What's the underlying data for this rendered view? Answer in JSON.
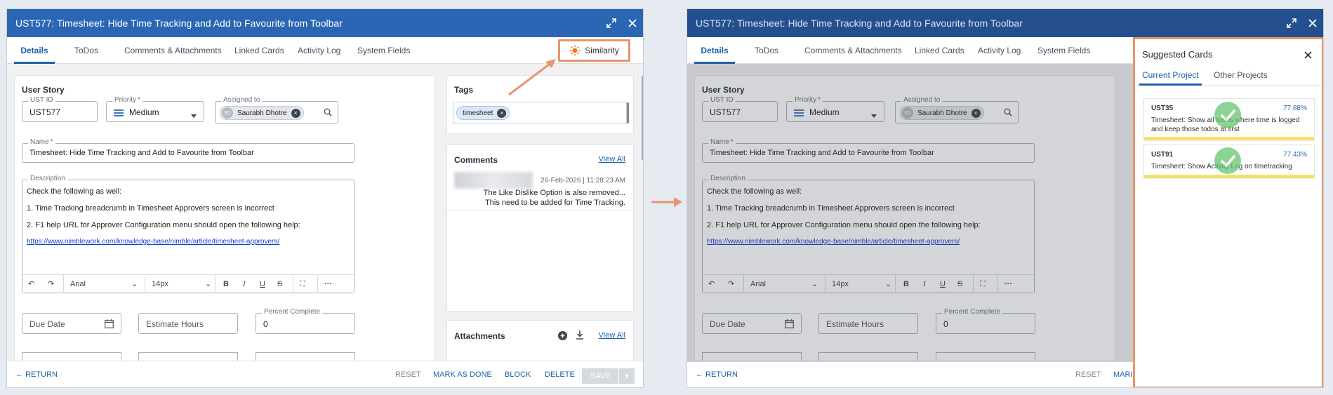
{
  "window": {
    "title": "UST577: Timesheet: Hide Time Tracking and Add to Favourite from Toolbar",
    "tabs": [
      "Details",
      "ToDos",
      "Comments & Attachments",
      "Linked Cards",
      "Activity Log",
      "System Fields"
    ],
    "similarity_label": "Similarity"
  },
  "details": {
    "section_title": "User Story",
    "ust_id": {
      "label": "UST ID",
      "value": "UST577"
    },
    "priority": {
      "label": "Priority",
      "value": "Medium"
    },
    "assigned_to": {
      "label": "Assigned to",
      "initials": "SD",
      "name": "Saurabh Dhotre"
    },
    "name": {
      "label": "Name",
      "value": "Timesheet: Hide Time Tracking and Add to Favourite from Toolbar"
    },
    "description": {
      "label": "Description",
      "lines": [
        "Check the following as well:",
        "1. Time Tracking breadcrumb in Timesheet Approvers screen is incorrect",
        "2. F1 help URL for Approver Configuration menu should open the following help:"
      ],
      "link": "https://www.nimblework.com/knowledge-base/nimble/article/timesheet-approvers/"
    },
    "editor": {
      "font": "Arial",
      "size": "14px"
    },
    "due_date_placeholder": "Due Date",
    "estimate_hours_placeholder": "Estimate Hours",
    "percent_complete": {
      "label": "Percent Complete",
      "value": "0"
    }
  },
  "side": {
    "tags_title": "Tags",
    "tag": "timesheet",
    "comments_title": "Comments",
    "view_all": "View All",
    "comment": {
      "date": "26-Feb-2026 | 11:28:23 AM",
      "line1": "The Like Dislike Option is also removed...",
      "line2": "This need to be added for Time Tracking."
    },
    "attachments_title": "Attachments"
  },
  "footer": {
    "return": "RETURN",
    "reset": "RESET",
    "mark_done": "MARK AS DONE",
    "block": "BLOCK",
    "delete": "DELETE",
    "save": "SAVE",
    "mark_truncated": "MARI"
  },
  "suggested": {
    "title": "Suggested Cards",
    "tabs": [
      "Current Project",
      "Other Projects"
    ],
    "cards": [
      {
        "id": "UST35",
        "percent": "77.88%",
        "text": "Timesheet: Show all todos where time is logged and keep those todos at first"
      },
      {
        "id": "UST91",
        "percent": "77.43%",
        "text": "Timesheet: Show Activity Log on timetracking"
      }
    ]
  },
  "colors": {
    "accent": "#2b66b5",
    "highlight": "#e8956a",
    "card_bar": "#f3e36b",
    "check": "#62c46c"
  }
}
